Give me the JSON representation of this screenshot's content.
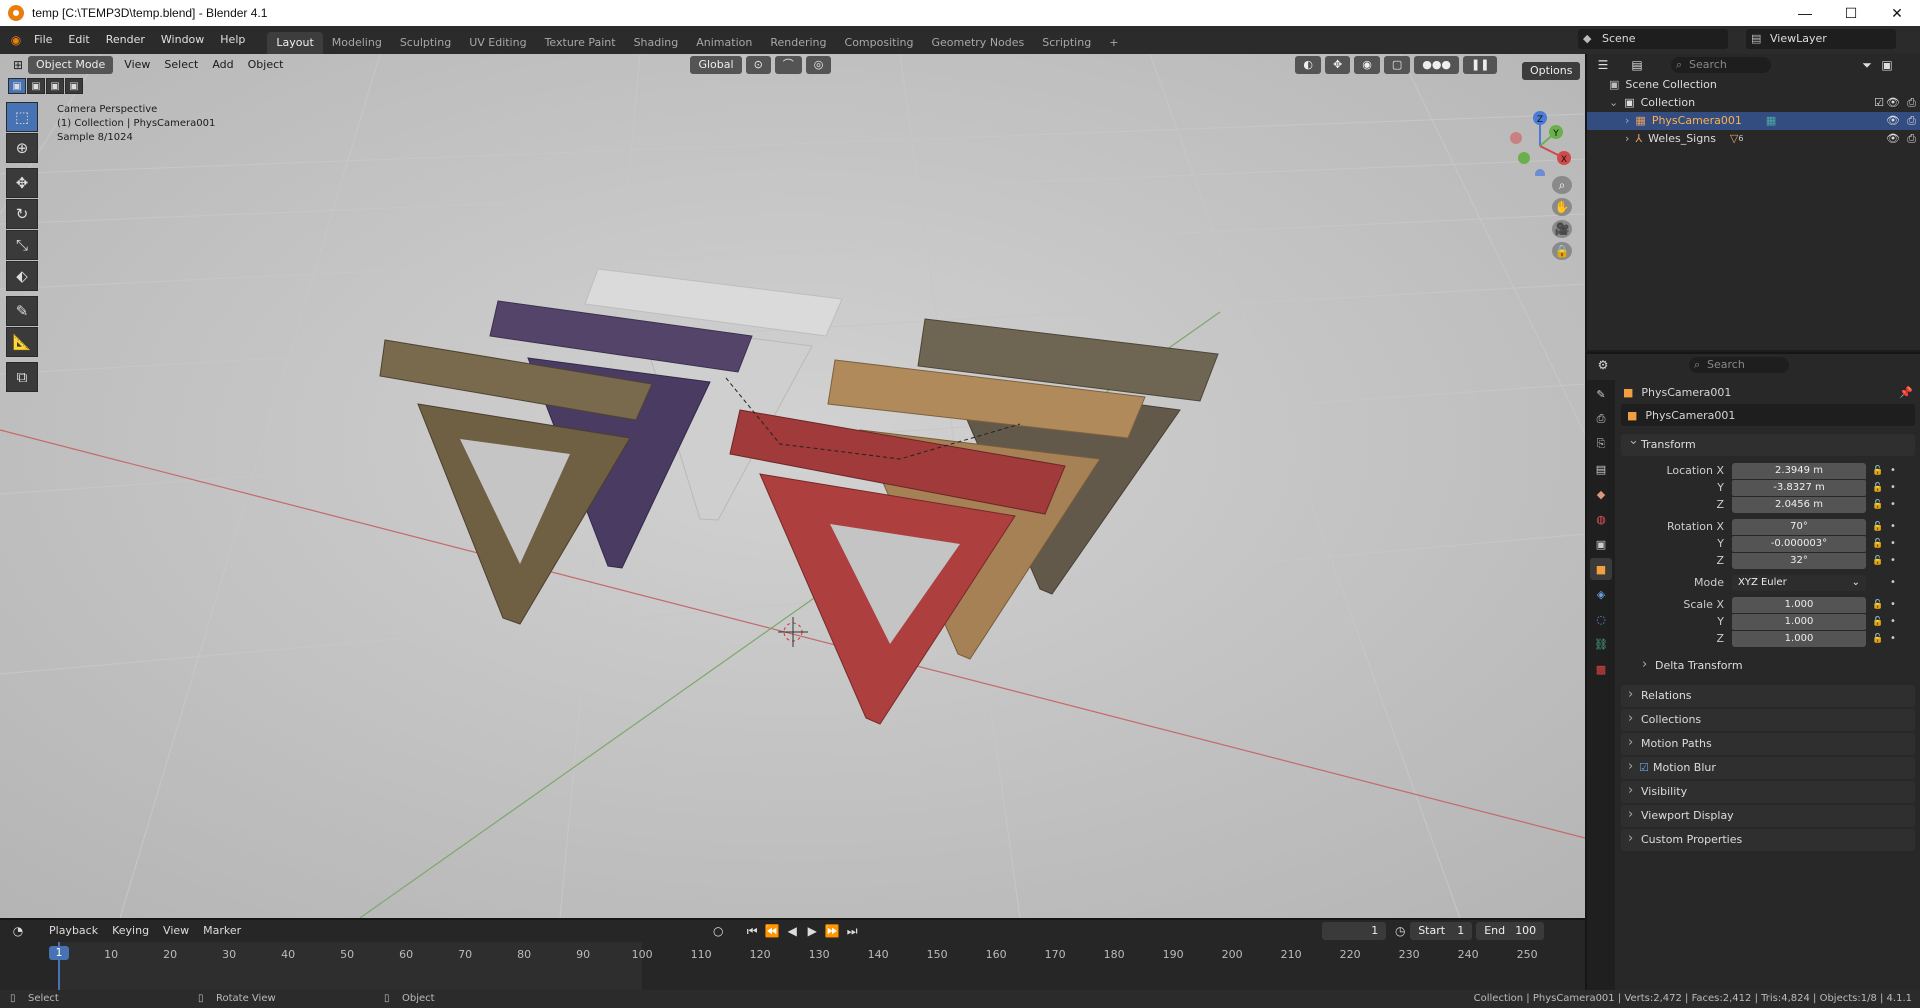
{
  "window": {
    "title": "temp [C:\\TEMP3D\\temp.blend] - Blender 4.1",
    "minimize": "—",
    "maximize": "☐",
    "close": "✕"
  },
  "menu": {
    "items": [
      "File",
      "Edit",
      "Render",
      "Window",
      "Help"
    ]
  },
  "workspaces": {
    "tabs": [
      "Layout",
      "Modeling",
      "Sculpting",
      "UV Editing",
      "Texture Paint",
      "Shading",
      "Animation",
      "Rendering",
      "Compositing",
      "Geometry Nodes",
      "Scripting"
    ],
    "active": "Layout",
    "add": "+"
  },
  "scene": {
    "label": "Scene",
    "view_layer": "ViewLayer"
  },
  "viewport": {
    "mode": "Object Mode",
    "menus": [
      "View",
      "Select",
      "Add",
      "Object"
    ],
    "orientation": "Global",
    "options": "Options",
    "overlay_lines": [
      "Camera Perspective",
      "(1) Collection | PhysCamera001",
      "Sample 8/1024"
    ],
    "gizmo": {
      "z": "Z",
      "y": "Y",
      "x": "X"
    }
  },
  "outliner": {
    "search_placeholder": "Search",
    "root": "Scene Collection",
    "collection": "Collection",
    "items": [
      {
        "name": "PhysCamera001",
        "selected": true
      },
      {
        "name": "Weles_Signs",
        "selected": false,
        "badge": "6"
      }
    ]
  },
  "properties": {
    "search_placeholder": "Search",
    "object_name": "PhysCamera001",
    "datablock": "PhysCamera001",
    "transform_label": "Transform",
    "location_label": "Location X",
    "location": [
      "2.3949 m",
      "-3.8327 m",
      "2.0456 m"
    ],
    "rotation_label": "Rotation X",
    "rotation": [
      "70°",
      "-0.000003°",
      "32°"
    ],
    "mode_label": "Mode",
    "mode_value": "XYZ Euler",
    "scale_label": "Scale X",
    "scale": [
      "1.000",
      "1.000",
      "1.000"
    ],
    "axis_y": "Y",
    "axis_z": "Z",
    "delta": "Delta Transform",
    "panels": [
      "Relations",
      "Collections",
      "Motion Paths",
      "Motion Blur",
      "Visibility",
      "Viewport Display",
      "Custom Properties"
    ]
  },
  "timeline": {
    "menus": [
      "Playback",
      "Keying",
      "View",
      "Marker"
    ],
    "current_frame": "1",
    "start_label": "Start",
    "start": "1",
    "end_label": "End",
    "end": "100",
    "ticks": [
      "1",
      "10",
      "20",
      "30",
      "40",
      "50",
      "60",
      "70",
      "80",
      "90",
      "100",
      "110",
      "120",
      "130",
      "140",
      "150",
      "160",
      "170",
      "180",
      "190",
      "200",
      "210",
      "220",
      "230",
      "240",
      "250"
    ]
  },
  "status": {
    "left": [
      "Select",
      "Rotate View",
      "Object"
    ],
    "right": "Collection | PhysCamera001 | Verts:2,472 | Faces:2,412 | Tris:4,824 | Objects:1/8 | 4.1.1"
  }
}
